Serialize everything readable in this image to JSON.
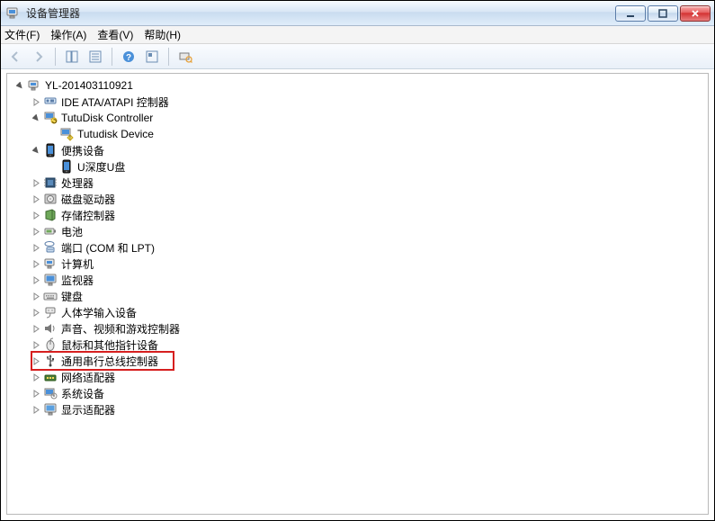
{
  "window": {
    "title": "设备管理器"
  },
  "menu": {
    "file": "文件(F)",
    "action": "操作(A)",
    "view": "查看(V)",
    "help": "帮助(H)"
  },
  "tree": {
    "root": "YL-201403110921",
    "ide": "IDE ATA/ATAPI 控制器",
    "tutudisk_ctrl": "TutuDisk Controller",
    "tutudisk_dev": "Tutudisk Device",
    "portable": "便携设备",
    "udisk": "U深度U盘",
    "processor": "处理器",
    "disk": "磁盘驱动器",
    "storage": "存储控制器",
    "battery": "电池",
    "ports": "端口 (COM 和 LPT)",
    "computer": "计算机",
    "monitor": "监视器",
    "keyboard": "键盘",
    "hid": "人体学输入设备",
    "sound": "声音、视频和游戏控制器",
    "mouse": "鼠标和其他指针设备",
    "usb": "通用串行总线控制器",
    "network": "网络适配器",
    "system": "系统设备",
    "display": "显示适配器"
  }
}
